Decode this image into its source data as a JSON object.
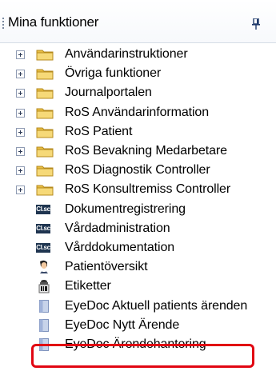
{
  "panel": {
    "title": "Mina funktioner",
    "pin_icon": "pin-icon"
  },
  "items": [
    {
      "label": "Användarinstruktioner",
      "icon": "folder-icon",
      "expandable": true
    },
    {
      "label": "Övriga funktioner",
      "icon": "folder-icon",
      "expandable": true
    },
    {
      "label": "Journalportalen",
      "icon": "folder-icon",
      "expandable": true
    },
    {
      "label": "RoS Användarinformation",
      "icon": "folder-icon",
      "expandable": true
    },
    {
      "label": "RoS Patient",
      "icon": "folder-icon",
      "expandable": true
    },
    {
      "label": "RoS Bevakning Medarbetare",
      "icon": "folder-icon",
      "expandable": true
    },
    {
      "label": "RoS Diagnostik Controller",
      "icon": "folder-icon",
      "expandable": true
    },
    {
      "label": "RoS Konsultremiss Controller",
      "icon": "folder-icon",
      "expandable": true
    },
    {
      "label": "Dokumentregistrering",
      "icon": "app-badge-icon",
      "badge_text": "Cl.sc",
      "expandable": false
    },
    {
      "label": "Vårdadministration",
      "icon": "app-badge-icon",
      "badge_text": "Cl.sc",
      "expandable": false
    },
    {
      "label": "Vårddokumentation",
      "icon": "app-badge-icon",
      "badge_text": "Cl.sc",
      "expandable": false
    },
    {
      "label": "Patientöversikt",
      "icon": "person-icon",
      "expandable": false
    },
    {
      "label": "Etiketter",
      "icon": "label-icon",
      "expandable": false
    },
    {
      "label": "EyeDoc Aktuell patients ärenden",
      "icon": "document-icon",
      "expandable": false
    },
    {
      "label": "EyeDoc Nytt Ärende",
      "icon": "document-icon",
      "expandable": false,
      "highlighted": true
    },
    {
      "label": "EyeDoc Ärendehantering",
      "icon": "document-icon",
      "expandable": false
    }
  ],
  "colors": {
    "highlight": "#e10612",
    "folder": "#f2cf5b",
    "badge": "#1f3550"
  }
}
